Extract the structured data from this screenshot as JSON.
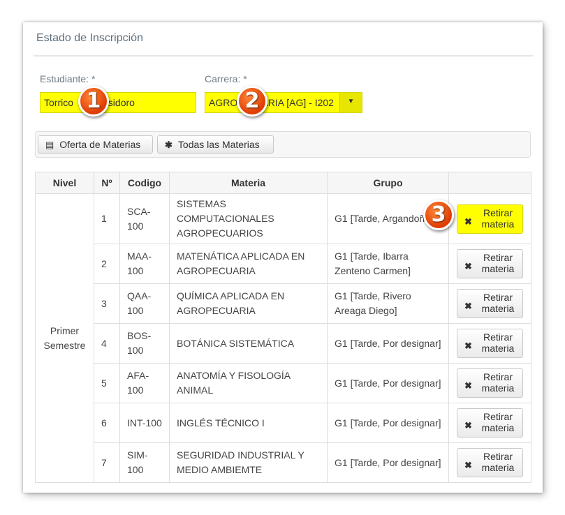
{
  "panel": {
    "title": "Estado de Inscripción"
  },
  "form": {
    "student_label": "Estudiante:",
    "student_value": "Torrico          i Isidoro",
    "career_label": "Carrera:",
    "career_value": "AGRO         ARIA [AG] - I202",
    "required_mark": "*"
  },
  "toolbar": {
    "offer_label": "Oferta de Materias",
    "all_label": "Todas las Materias"
  },
  "table": {
    "headers": [
      "Nivel",
      "Nº",
      "Codigo",
      "Materia",
      "Grupo",
      ""
    ],
    "level": "Primer Semestre",
    "remove_label": "Retirar materia",
    "rows": [
      {
        "num": "1",
        "code": "SCA-100",
        "subject": "SISTEMAS COMPUTACIONALES AGROPECUARIOS",
        "group": "G1 [Tarde, Argandoña Arcienegas Alberto]"
      },
      {
        "num": "2",
        "code": "MAA-100",
        "subject": "MATENÁTICA APLICADA EN AGROPECUARIA",
        "group": "G1 [Tarde, Ibarra Zenteno Carmen]"
      },
      {
        "num": "3",
        "code": "QAA-100",
        "subject": "QUÍMICA APLICADA EN AGROPECUARIA",
        "group": "G1 [Tarde, Rivero Areaga Diego]"
      },
      {
        "num": "4",
        "code": "BOS-100",
        "subject": "BOTÁNICA SISTEMÁTICA",
        "group": "G1 [Tarde, Por designar]"
      },
      {
        "num": "5",
        "code": "AFA-100",
        "subject": "ANATOMÍA Y FISOLOGÍA ANIMAL",
        "group": "G1 [Tarde, Por designar]"
      },
      {
        "num": "6",
        "code": "INT-100",
        "subject": "INGLÉS TÉCNICO I",
        "group": "G1 [Tarde, Por designar]"
      },
      {
        "num": "7",
        "code": "SIM-100",
        "subject": "SEGURIDAD INDUSTRIAL Y MEDIO AMBIEMTE",
        "group": "G1 [Tarde, Por designar]"
      }
    ]
  },
  "badges": {
    "one": "1",
    "two": "2",
    "three": "3"
  },
  "icons": {
    "list": "list-icon",
    "asterisk": "asterisk-icon",
    "remove": "times-icon",
    "caret": "caret-down-icon"
  },
  "colors": {
    "highlight": "#ffff00",
    "badge": "#e84a0c"
  }
}
